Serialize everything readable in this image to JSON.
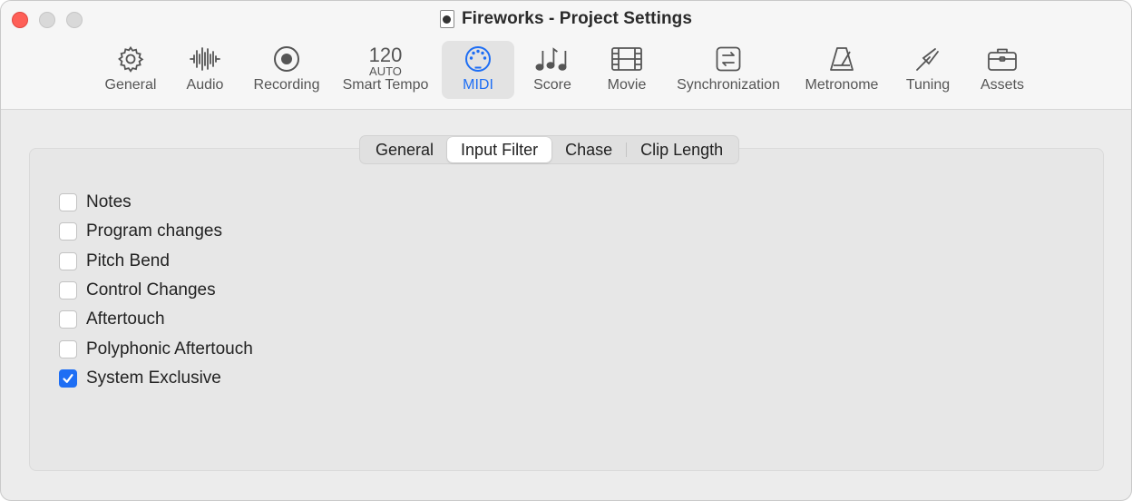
{
  "window": {
    "title": "Fireworks - Project Settings"
  },
  "toolbar": {
    "items": [
      {
        "label": "General",
        "icon": "gear-icon"
      },
      {
        "label": "Audio",
        "icon": "waveform-icon"
      },
      {
        "label": "Recording",
        "icon": "record-icon"
      },
      {
        "label": "Smart Tempo",
        "icon": "tempo-readout",
        "tempo_value": "120",
        "tempo_mode": "AUTO"
      },
      {
        "label": "MIDI",
        "icon": "midi-connector-icon",
        "selected": true
      },
      {
        "label": "Score",
        "icon": "music-notes-icon"
      },
      {
        "label": "Movie",
        "icon": "film-icon"
      },
      {
        "label": "Synchronization",
        "icon": "sync-arrows-icon"
      },
      {
        "label": "Metronome",
        "icon": "metronome-icon"
      },
      {
        "label": "Tuning",
        "icon": "tuning-fork-icon"
      },
      {
        "label": "Assets",
        "icon": "briefcase-icon"
      }
    ]
  },
  "tabs": [
    {
      "label": "General"
    },
    {
      "label": "Input Filter",
      "active": true
    },
    {
      "label": "Chase"
    },
    {
      "label": "Clip Length"
    }
  ],
  "filters": [
    {
      "label": "Notes",
      "checked": false
    },
    {
      "label": "Program changes",
      "checked": false
    },
    {
      "label": "Pitch Bend",
      "checked": false
    },
    {
      "label": "Control Changes",
      "checked": false
    },
    {
      "label": "Aftertouch",
      "checked": false
    },
    {
      "label": "Polyphonic Aftertouch",
      "checked": false
    },
    {
      "label": "System Exclusive",
      "checked": true
    }
  ],
  "colors": {
    "accent": "#1e6ef4",
    "close": "#fe5f57"
  }
}
